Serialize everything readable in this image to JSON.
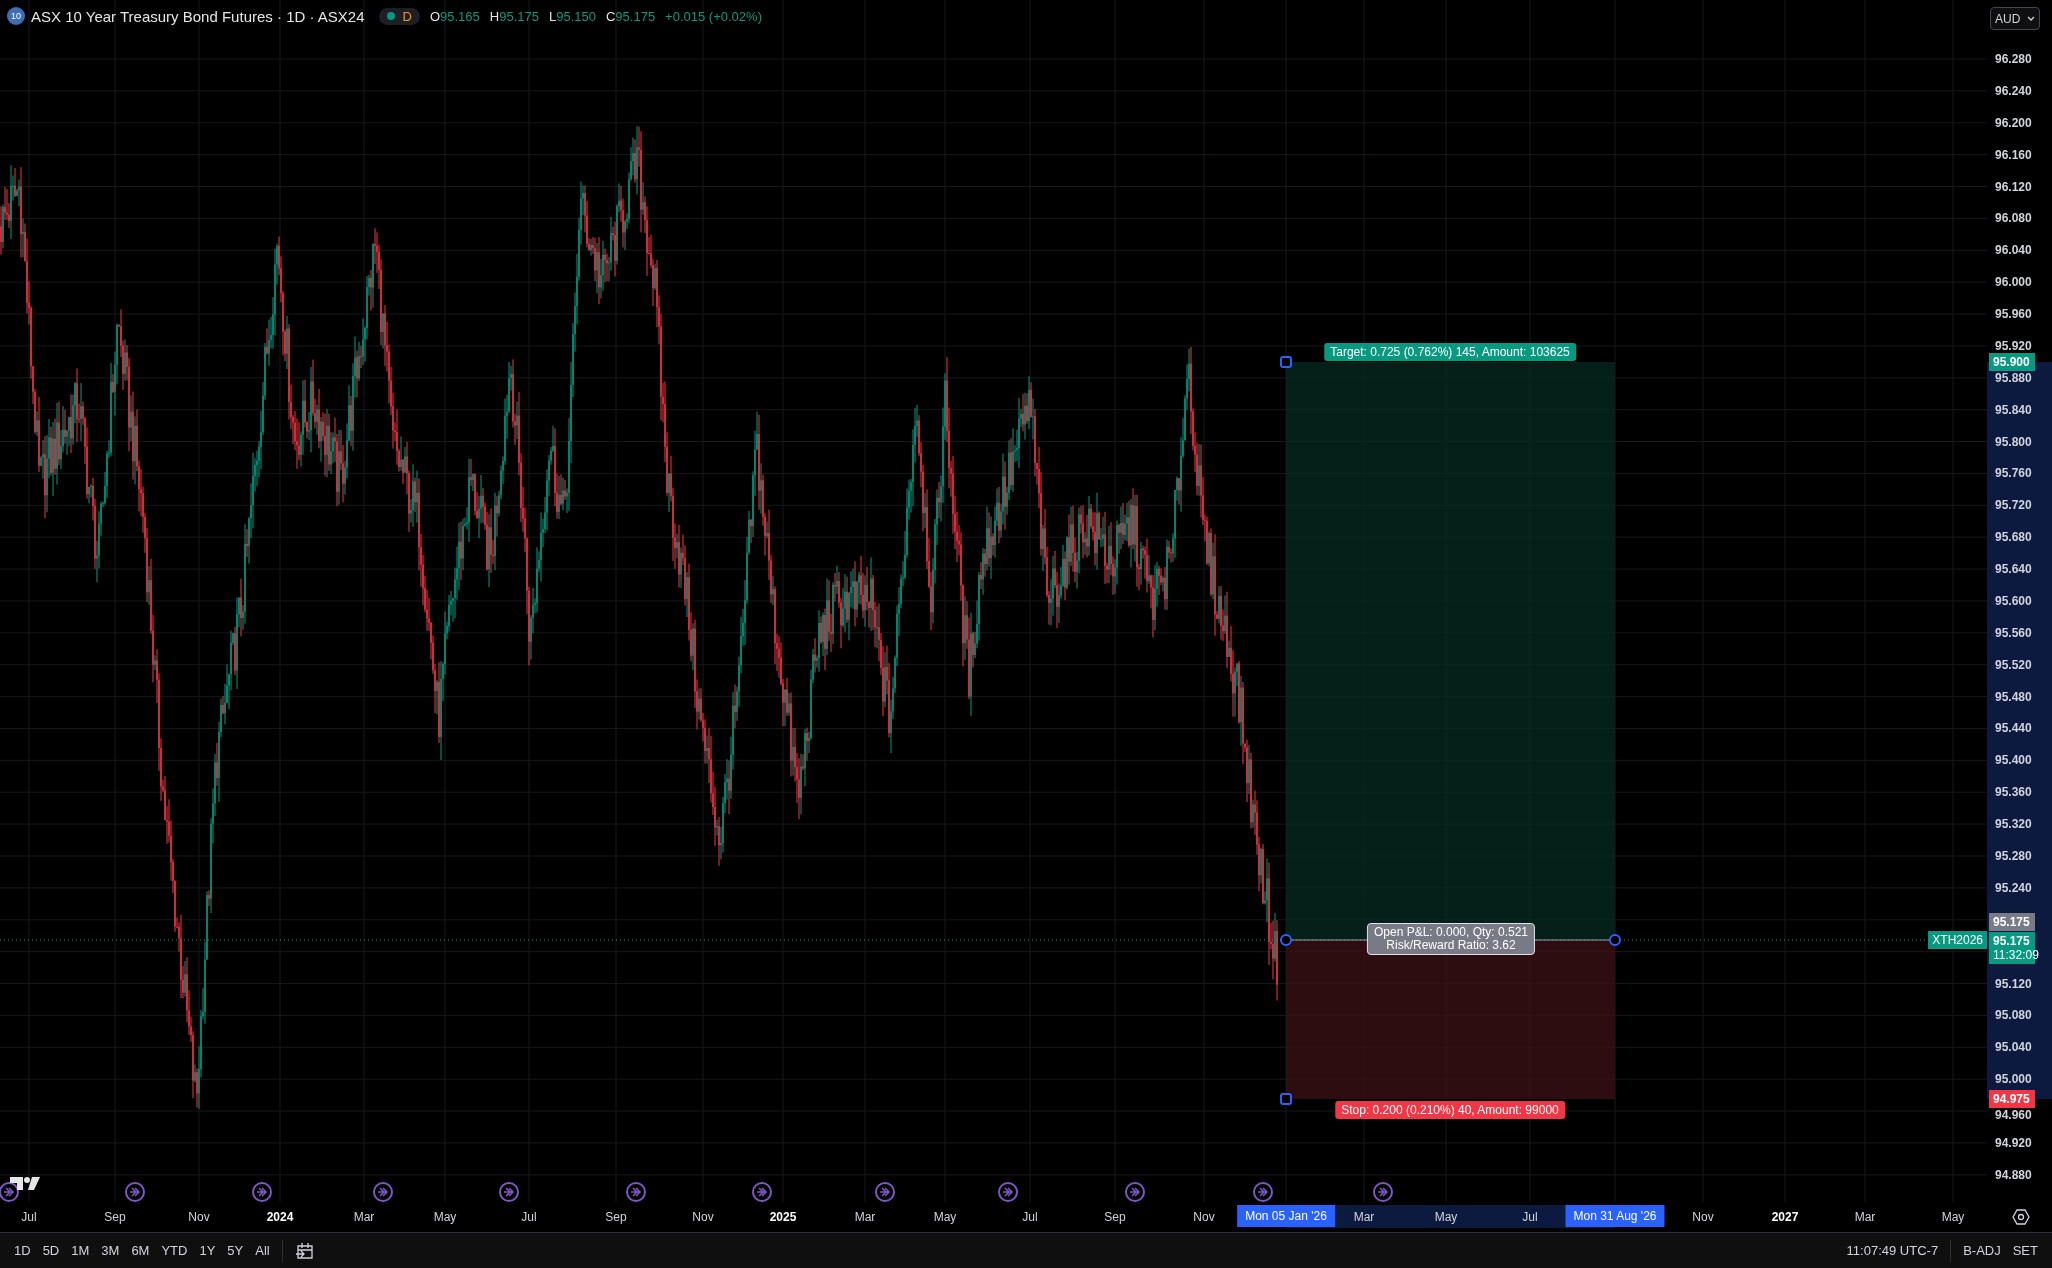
{
  "legend": {
    "badge": "10",
    "title": "ASX 10 Year Treasury Bond Futures · 1D · ASX24",
    "market_status": "D",
    "ohlc": [
      {
        "label": "O",
        "value": "95.165"
      },
      {
        "label": "H",
        "value": "95.175"
      },
      {
        "label": "L",
        "value": "95.150"
      },
      {
        "label": "C",
        "value": "95.175"
      }
    ],
    "change": "+0.015 (+0.02%)"
  },
  "currency": "AUD",
  "price_axis": {
    "ticks": [
      "96.280",
      "96.240",
      "96.200",
      "96.160",
      "96.120",
      "96.080",
      "96.040",
      "96.000",
      "95.960",
      "95.920",
      "95.880",
      "95.840",
      "95.800",
      "95.760",
      "95.720",
      "95.680",
      "95.640",
      "95.600",
      "95.560",
      "95.520",
      "95.480",
      "95.440",
      "95.400",
      "95.360",
      "95.320",
      "95.280",
      "95.240",
      "95.120",
      "95.080",
      "95.040",
      "95.000",
      "94.960",
      "94.920",
      "94.880"
    ]
  },
  "price_tags": [
    {
      "kind": "target",
      "text": "95.900"
    },
    {
      "kind": "entry",
      "text": "95.175"
    },
    {
      "kind": "last",
      "text": "95.175",
      "countdown": "11:32:09"
    },
    {
      "kind": "stop",
      "text": "94.975"
    }
  ],
  "symbol_tag": "XTH2026",
  "position": {
    "target_label": "Target: 0.725 (0.762%) 145, Amount: 103625",
    "stop_label": "Stop: 0.200 (0.210%) 40, Amount: 99000",
    "stats": [
      "Open P&L: 0.000, Qty: 0.521",
      "Risk/Reward Ratio: 3.62"
    ]
  },
  "time_axis": [
    {
      "kind": "month",
      "text": "Jul"
    },
    {
      "kind": "month",
      "text": "Sep"
    },
    {
      "kind": "month",
      "text": "Nov"
    },
    {
      "kind": "year",
      "text": "2024"
    },
    {
      "kind": "month",
      "text": "Mar"
    },
    {
      "kind": "month",
      "text": "May"
    },
    {
      "kind": "month",
      "text": "Jul"
    },
    {
      "kind": "month",
      "text": "Sep"
    },
    {
      "kind": "month",
      "text": "Nov"
    },
    {
      "kind": "year",
      "text": "2025"
    },
    {
      "kind": "month",
      "text": "Mar"
    },
    {
      "kind": "month",
      "text": "May"
    },
    {
      "kind": "month",
      "text": "Jul"
    },
    {
      "kind": "month",
      "text": "Sep"
    },
    {
      "kind": "month",
      "text": "Nov"
    },
    {
      "kind": "range",
      "text": "Mon 05 Jan '26"
    },
    {
      "kind": "month",
      "text": "Mar"
    },
    {
      "kind": "month",
      "text": "May"
    },
    {
      "kind": "month",
      "text": "Jul"
    },
    {
      "kind": "range",
      "text": "Mon 31 Aug '26"
    },
    {
      "kind": "month",
      "text": "Nov"
    },
    {
      "kind": "year",
      "text": "2027"
    },
    {
      "kind": "month",
      "text": "Mar"
    },
    {
      "kind": "month",
      "text": "May"
    }
  ],
  "ranges": [
    "1D",
    "5D",
    "1M",
    "3M",
    "6M",
    "YTD",
    "1Y",
    "5Y",
    "All"
  ],
  "status": {
    "time": "11:07:49 UTC-7",
    "items": [
      "B-ADJ",
      "SET"
    ]
  }
}
